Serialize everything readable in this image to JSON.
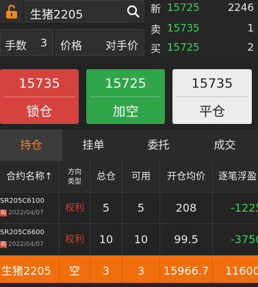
{
  "search": {
    "symbol": "生猪2205"
  },
  "quotes": [
    {
      "label": "新",
      "price": "15725",
      "volume": "2246"
    },
    {
      "label": "卖",
      "price": "15735",
      "volume": "1"
    },
    {
      "label": "买",
      "price": "15725",
      "volume": "2"
    }
  ],
  "order": {
    "qty_label": "手数",
    "qty_value": "3",
    "price_label": "价格",
    "price_value": "对手价"
  },
  "actions": [
    {
      "price": "15735",
      "label": "锁仓"
    },
    {
      "price": "15725",
      "label": "加空"
    },
    {
      "price": "15735",
      "label": "平仓"
    }
  ],
  "tabs": [
    "持仓",
    "挂单",
    "委托",
    "成交"
  ],
  "table": {
    "headers": [
      "合约名称↑",
      "方向类型",
      "总仓",
      "可用",
      "开仓均价",
      "逐笔浮盈"
    ],
    "rows": [
      {
        "code": "SR205C6100",
        "badge": "购",
        "date": "2022/04/07",
        "dir": "权利",
        "total": "5",
        "avail": "5",
        "avg": "208",
        "pnl": "-1225"
      },
      {
        "code": "SR205C6600",
        "badge": "购",
        "date": "2022/04/07",
        "dir": "权利",
        "total": "10",
        "avail": "10",
        "avg": "99.5",
        "pnl": "-3750"
      },
      {
        "name": "生猪2205",
        "dir": "空",
        "total": "3",
        "avail": "3",
        "avg": "15966.7",
        "pnl": "11600"
      }
    ]
  },
  "colors": {
    "accent": "#f06f0c",
    "up": "#d83a2e",
    "down": "#3ed05a"
  }
}
